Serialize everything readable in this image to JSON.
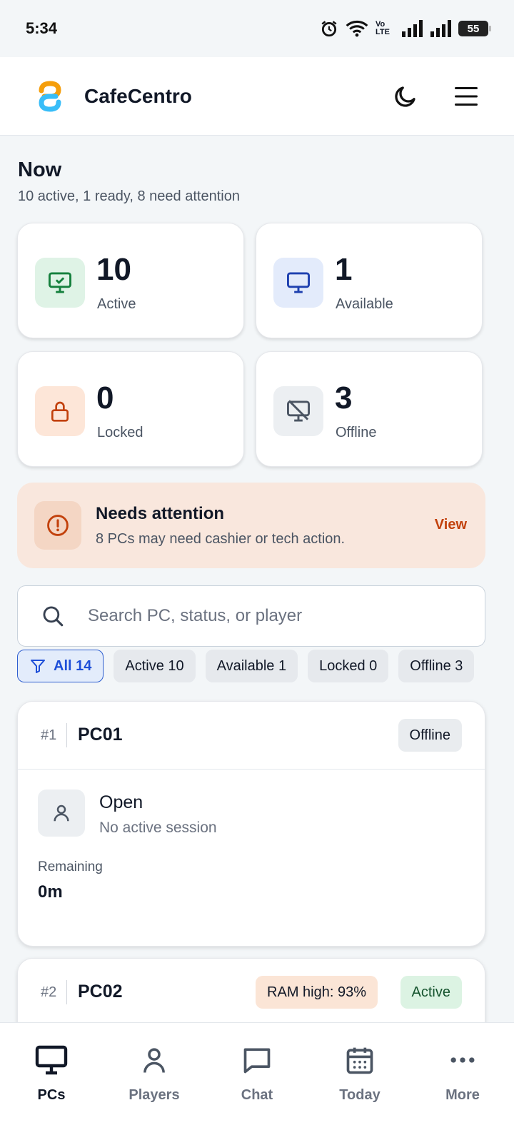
{
  "status_bar": {
    "time": "5:34",
    "network_label": "Vo LTE",
    "battery": "55"
  },
  "app": {
    "brand": "CafeCentro"
  },
  "now": {
    "title": "Now",
    "subtitle": "10 active, 1 ready, 8 need attention"
  },
  "stats": [
    {
      "value": "10",
      "label": "Active",
      "color": "#15803d",
      "bg": "#dff3e6"
    },
    {
      "value": "1",
      "label": "Available",
      "color": "#1e40af",
      "bg": "#e3ebfb"
    },
    {
      "value": "0",
      "label": "Locked",
      "color": "#c2410c",
      "bg": "#fde6d8"
    },
    {
      "value": "3",
      "label": "Offline",
      "color": "#4b5563",
      "bg": "#eceff2"
    }
  ],
  "attention": {
    "title": "Needs attention",
    "message": "8 PCs may need cashier or tech action.",
    "action": "View"
  },
  "search": {
    "placeholder": "Search PC, status, or player"
  },
  "filters": [
    {
      "label": "All 14",
      "selected": true
    },
    {
      "label": "Active 10",
      "selected": false
    },
    {
      "label": "Available 1",
      "selected": false
    },
    {
      "label": "Locked 0",
      "selected": false
    },
    {
      "label": "Offline 3",
      "selected": false
    }
  ],
  "pcs": [
    {
      "index": "#1",
      "name": "PC01",
      "status": "Offline",
      "session_title": "Open",
      "session_sub": "No active session",
      "remaining_label": "Remaining",
      "remaining_value": "0m"
    },
    {
      "index": "#2",
      "name": "PC02",
      "status": "Active",
      "warning": "RAM high: 93%"
    }
  ],
  "nav": [
    {
      "label": "PCs",
      "icon": "monitor-icon",
      "selected": true
    },
    {
      "label": "Players",
      "icon": "user-icon",
      "selected": false
    },
    {
      "label": "Chat",
      "icon": "chat-icon",
      "selected": false
    },
    {
      "label": "Today",
      "icon": "calendar-icon",
      "selected": false
    },
    {
      "label": "More",
      "icon": "more-icon",
      "selected": false
    }
  ]
}
